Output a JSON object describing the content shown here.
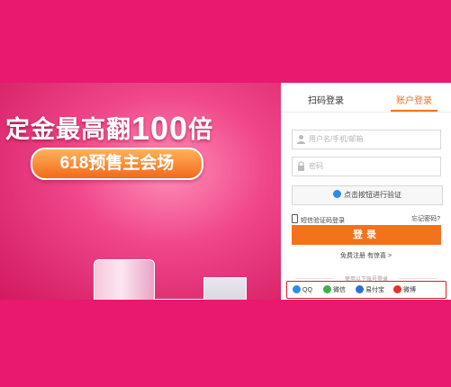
{
  "banner": {
    "headline_prefix": "定金最高翻",
    "headline_number": "100",
    "headline_suffix": "倍",
    "sub_pill": "618预售主会场"
  },
  "login": {
    "tabs": [
      {
        "label": "扫码登录",
        "active": false
      },
      {
        "label": "账户登录",
        "active": true
      }
    ],
    "username_placeholder": "用户名/手机/邮箱",
    "password_placeholder": "密码",
    "verify_button": "点击按钮进行验证",
    "sms_login": "短信验证码登录",
    "forgot_password": "忘记密码?",
    "login_button": "登录",
    "register_text": "免费注册 有惊喜 >",
    "other_login_title": "使用以下账号登录",
    "social": [
      {
        "label": "QQ",
        "icon": "qq-icon",
        "color": "#2b8de8"
      },
      {
        "label": "微信",
        "icon": "wechat-icon",
        "color": "#3bb34a"
      },
      {
        "label": "易付宝",
        "icon": "yifubao-icon",
        "color": "#2b6fd8"
      },
      {
        "label": "微博",
        "icon": "weibo-icon",
        "color": "#e2332a"
      }
    ]
  },
  "colors": {
    "background": "#e8196e",
    "accent": "#f3721c",
    "highlight_border": "#e11b2b"
  }
}
